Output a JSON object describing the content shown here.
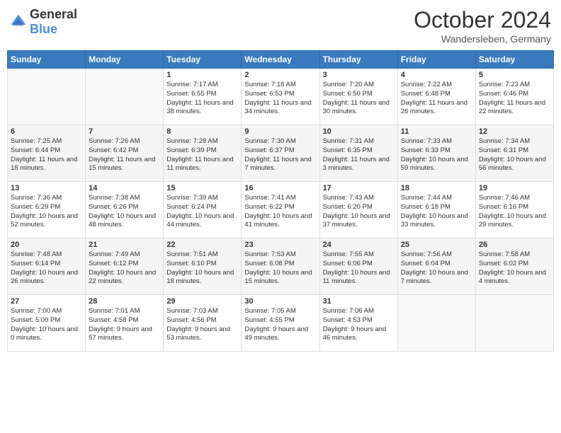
{
  "header": {
    "logo_general": "General",
    "logo_blue": "Blue",
    "month_title": "October 2024",
    "location": "Wandersleben, Germany"
  },
  "days_of_week": [
    "Sunday",
    "Monday",
    "Tuesday",
    "Wednesday",
    "Thursday",
    "Friday",
    "Saturday"
  ],
  "weeks": [
    [
      {
        "day": "",
        "info": ""
      },
      {
        "day": "",
        "info": ""
      },
      {
        "day": "1",
        "info": "Sunrise: 7:17 AM\nSunset: 6:55 PM\nDaylight: 11 hours and 38 minutes."
      },
      {
        "day": "2",
        "info": "Sunrise: 7:18 AM\nSunset: 6:53 PM\nDaylight: 11 hours and 34 minutes."
      },
      {
        "day": "3",
        "info": "Sunrise: 7:20 AM\nSunset: 6:50 PM\nDaylight: 11 hours and 30 minutes."
      },
      {
        "day": "4",
        "info": "Sunrise: 7:22 AM\nSunset: 6:48 PM\nDaylight: 11 hours and 26 minutes."
      },
      {
        "day": "5",
        "info": "Sunrise: 7:23 AM\nSunset: 6:46 PM\nDaylight: 11 hours and 22 minutes."
      }
    ],
    [
      {
        "day": "6",
        "info": "Sunrise: 7:25 AM\nSunset: 6:44 PM\nDaylight: 11 hours and 18 minutes."
      },
      {
        "day": "7",
        "info": "Sunrise: 7:26 AM\nSunset: 6:42 PM\nDaylight: 11 hours and 15 minutes."
      },
      {
        "day": "8",
        "info": "Sunrise: 7:28 AM\nSunset: 6:39 PM\nDaylight: 11 hours and 11 minutes."
      },
      {
        "day": "9",
        "info": "Sunrise: 7:30 AM\nSunset: 6:37 PM\nDaylight: 11 hours and 7 minutes."
      },
      {
        "day": "10",
        "info": "Sunrise: 7:31 AM\nSunset: 6:35 PM\nDaylight: 11 hours and 3 minutes."
      },
      {
        "day": "11",
        "info": "Sunrise: 7:33 AM\nSunset: 6:33 PM\nDaylight: 10 hours and 59 minutes."
      },
      {
        "day": "12",
        "info": "Sunrise: 7:34 AM\nSunset: 6:31 PM\nDaylight: 10 hours and 56 minutes."
      }
    ],
    [
      {
        "day": "13",
        "info": "Sunrise: 7:36 AM\nSunset: 6:29 PM\nDaylight: 10 hours and 52 minutes."
      },
      {
        "day": "14",
        "info": "Sunrise: 7:38 AM\nSunset: 6:26 PM\nDaylight: 10 hours and 48 minutes."
      },
      {
        "day": "15",
        "info": "Sunrise: 7:39 AM\nSunset: 6:24 PM\nDaylight: 10 hours and 44 minutes."
      },
      {
        "day": "16",
        "info": "Sunrise: 7:41 AM\nSunset: 6:22 PM\nDaylight: 10 hours and 41 minutes."
      },
      {
        "day": "17",
        "info": "Sunrise: 7:43 AM\nSunset: 6:20 PM\nDaylight: 10 hours and 37 minutes."
      },
      {
        "day": "18",
        "info": "Sunrise: 7:44 AM\nSunset: 6:18 PM\nDaylight: 10 hours and 33 minutes."
      },
      {
        "day": "19",
        "info": "Sunrise: 7:46 AM\nSunset: 6:16 PM\nDaylight: 10 hours and 29 minutes."
      }
    ],
    [
      {
        "day": "20",
        "info": "Sunrise: 7:48 AM\nSunset: 6:14 PM\nDaylight: 10 hours and 26 minutes."
      },
      {
        "day": "21",
        "info": "Sunrise: 7:49 AM\nSunset: 6:12 PM\nDaylight: 10 hours and 22 minutes."
      },
      {
        "day": "22",
        "info": "Sunrise: 7:51 AM\nSunset: 6:10 PM\nDaylight: 10 hours and 18 minutes."
      },
      {
        "day": "23",
        "info": "Sunrise: 7:53 AM\nSunset: 6:08 PM\nDaylight: 10 hours and 15 minutes."
      },
      {
        "day": "24",
        "info": "Sunrise: 7:55 AM\nSunset: 6:06 PM\nDaylight: 10 hours and 11 minutes."
      },
      {
        "day": "25",
        "info": "Sunrise: 7:56 AM\nSunset: 6:04 PM\nDaylight: 10 hours and 7 minutes."
      },
      {
        "day": "26",
        "info": "Sunrise: 7:58 AM\nSunset: 6:02 PM\nDaylight: 10 hours and 4 minutes."
      }
    ],
    [
      {
        "day": "27",
        "info": "Sunrise: 7:00 AM\nSunset: 5:00 PM\nDaylight: 10 hours and 0 minutes."
      },
      {
        "day": "28",
        "info": "Sunrise: 7:01 AM\nSunset: 4:58 PM\nDaylight: 9 hours and 57 minutes."
      },
      {
        "day": "29",
        "info": "Sunrise: 7:03 AM\nSunset: 4:56 PM\nDaylight: 9 hours and 53 minutes."
      },
      {
        "day": "30",
        "info": "Sunrise: 7:05 AM\nSunset: 4:55 PM\nDaylight: 9 hours and 49 minutes."
      },
      {
        "day": "31",
        "info": "Sunrise: 7:06 AM\nSunset: 4:53 PM\nDaylight: 9 hours and 46 minutes."
      },
      {
        "day": "",
        "info": ""
      },
      {
        "day": "",
        "info": ""
      }
    ]
  ]
}
